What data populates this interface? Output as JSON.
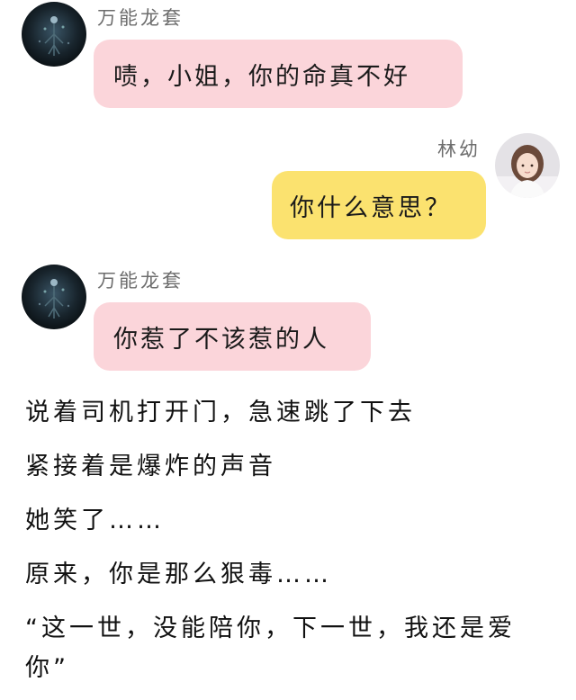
{
  "messages": [
    {
      "sender": "万能龙套",
      "text": "啧，小姐，你的命真不好",
      "side": "left",
      "bubble_color": "#fbd5da"
    },
    {
      "sender": "林幼",
      "text": "你什么意思？",
      "side": "right",
      "bubble_color": "#fbe26f"
    },
    {
      "sender": "万能龙套",
      "text": "你惹了不该惹的人",
      "side": "left",
      "bubble_color": "#fbd5da"
    }
  ],
  "narration": [
    "说着司机打开门，急速跳了下去",
    "紧接着是爆炸的声音",
    "她笑了……",
    "原来，你是那么狠毒……",
    "“这一世，没能陪你，下一世，我还是爱",
    "你”"
  ],
  "avatars": {
    "left": "dark-night-avatar-icon",
    "right": "girl-portrait-avatar-icon"
  }
}
